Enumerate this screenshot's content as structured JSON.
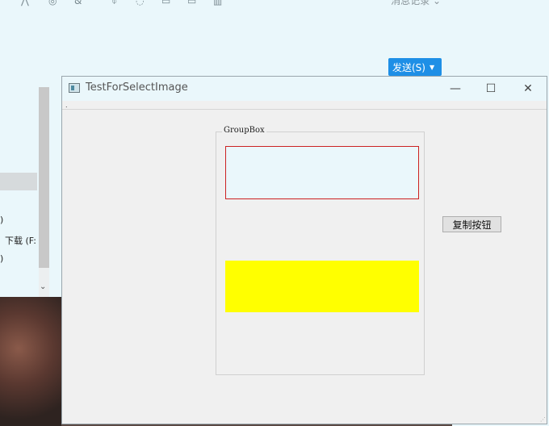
{
  "background_app": {
    "toolbar_icons": [
      "scissors-icon",
      "emoji-icon",
      "cut-icon",
      "mic-icon",
      "clock-icon",
      "image-icon",
      "folder-icon",
      "grid-icon"
    ],
    "message_log_label": "消息记录 ⌄",
    "send_button_label": "发送(S)",
    "send_dropdown_icon": "▼",
    "left_list_lines": [
      ")",
      "下载 (F:",
      ")"
    ],
    "colors": {
      "app_bg": "#eaf7fb",
      "send_bg": "#1e8fe6"
    }
  },
  "window": {
    "title": "TestForSelectImage",
    "controls": {
      "minimize": "—",
      "maximize": "☐",
      "close": "✕"
    },
    "menubar_text": "."
  },
  "groupbox": {
    "title": "GroupBox"
  },
  "copy_button_label": "复制按钮",
  "colors": {
    "red_box_border": "#cc2222",
    "red_box_fill": "#eaf7fb",
    "yellow_box_fill": "#ffff00",
    "window_bg": "#f0f0f0"
  }
}
